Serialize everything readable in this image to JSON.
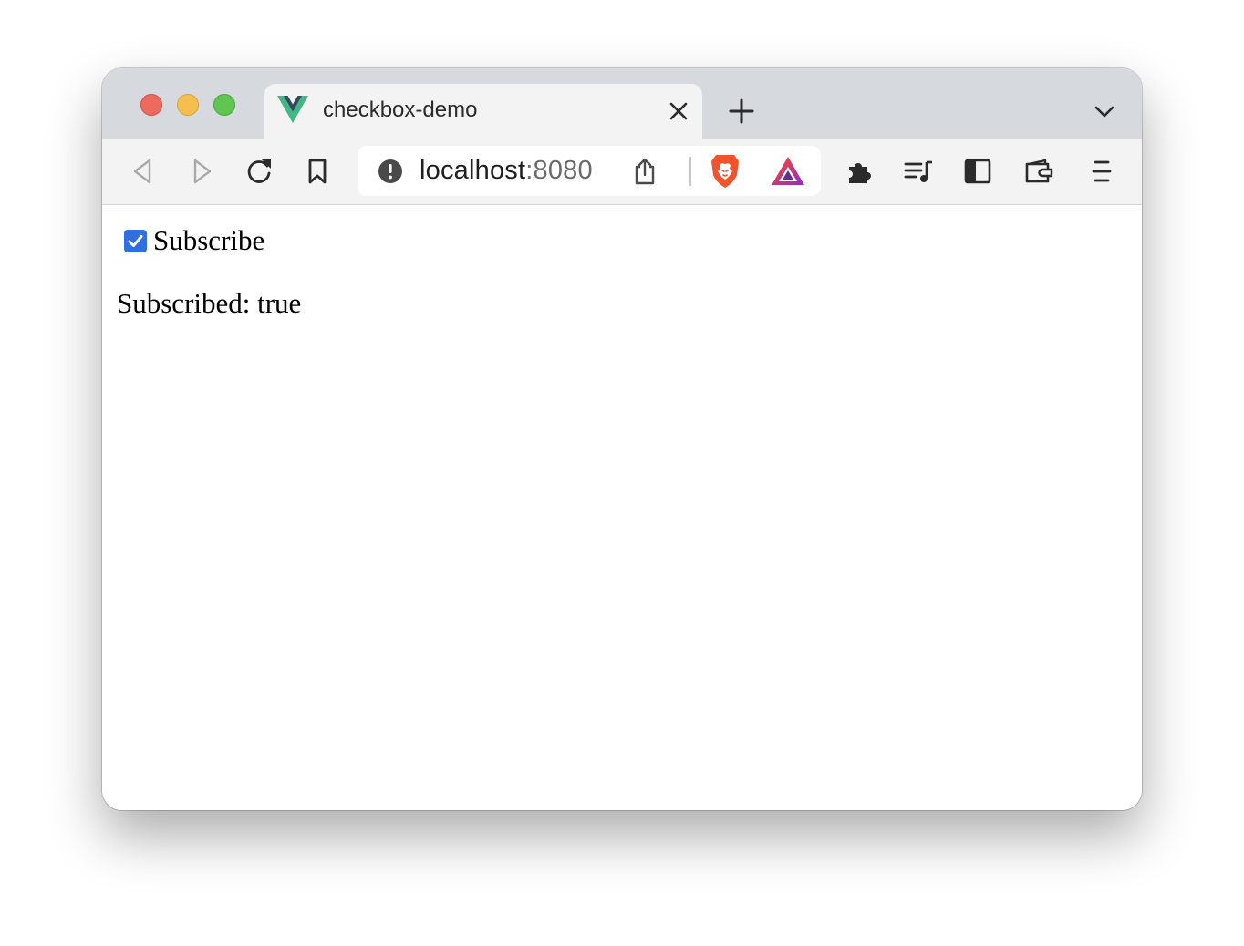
{
  "tab": {
    "title": "checkbox-demo",
    "favicon": "vue-logo-icon"
  },
  "omnibox": {
    "host": "localhost",
    "port": ":8080"
  },
  "colors": {
    "checkbox_accent": "#2f6fe0",
    "brave_orange": "#f0542d",
    "rewards_purple": "#8b2fc9"
  },
  "page": {
    "checkbox_label": "Subscribe",
    "checkbox_checked": true,
    "status_label": "Subscribed:",
    "status_value": "true"
  }
}
